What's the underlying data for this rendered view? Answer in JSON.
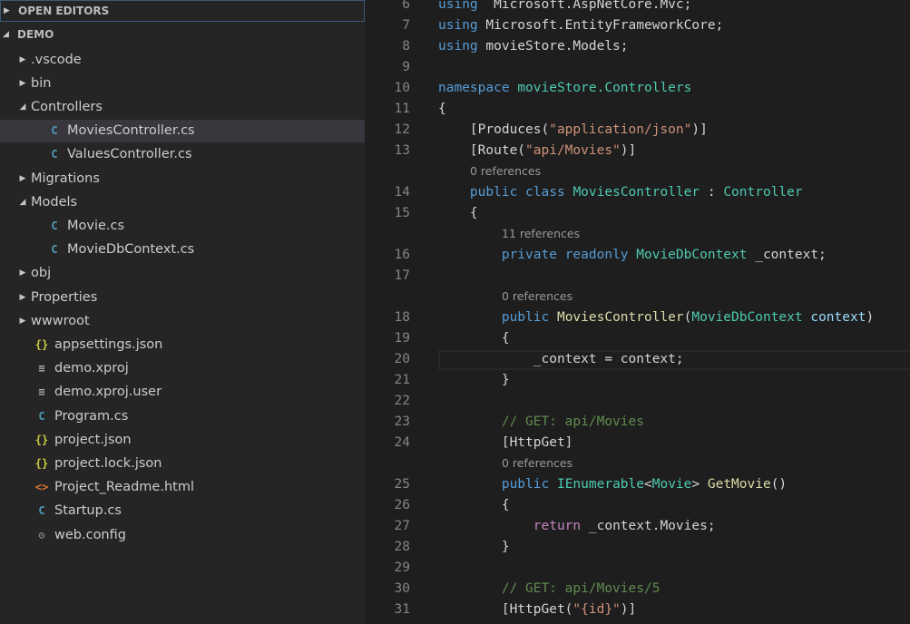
{
  "sidebar": {
    "open_editors_label": "OPEN EDITORS",
    "demo_label": "DEMO",
    "tree": [
      {
        "label": ".vscode",
        "kind": "folder",
        "expanded": false,
        "depth": 1
      },
      {
        "label": "bin",
        "kind": "folder",
        "expanded": false,
        "depth": 1
      },
      {
        "label": "Controllers",
        "kind": "folder",
        "expanded": true,
        "depth": 1
      },
      {
        "label": "MoviesController.cs",
        "kind": "cs",
        "depth": 2,
        "selected": true
      },
      {
        "label": "ValuesController.cs",
        "kind": "cs",
        "depth": 2
      },
      {
        "label": "Migrations",
        "kind": "folder",
        "expanded": false,
        "depth": 1
      },
      {
        "label": "Models",
        "kind": "folder",
        "expanded": true,
        "depth": 1
      },
      {
        "label": "Movie.cs",
        "kind": "cs",
        "depth": 2
      },
      {
        "label": "MovieDbContext.cs",
        "kind": "cs",
        "depth": 2
      },
      {
        "label": "obj",
        "kind": "folder",
        "expanded": false,
        "depth": 1
      },
      {
        "label": "Properties",
        "kind": "folder",
        "expanded": false,
        "depth": 1
      },
      {
        "label": "wwwroot",
        "kind": "folder",
        "expanded": false,
        "depth": 1
      },
      {
        "label": "appsettings.json",
        "kind": "json",
        "depth": 1
      },
      {
        "label": "demo.xproj",
        "kind": "doc",
        "depth": 1
      },
      {
        "label": "demo.xproj.user",
        "kind": "doc",
        "depth": 1
      },
      {
        "label": "Program.cs",
        "kind": "cs",
        "depth": 1
      },
      {
        "label": "project.json",
        "kind": "json",
        "depth": 1
      },
      {
        "label": "project.lock.json",
        "kind": "json",
        "depth": 1
      },
      {
        "label": "Project_Readme.html",
        "kind": "html",
        "depth": 1
      },
      {
        "label": "Startup.cs",
        "kind": "cs",
        "depth": 1
      },
      {
        "label": "web.config",
        "kind": "gear",
        "depth": 1
      }
    ],
    "icon_names": {
      "folder_collapsed": "chevron-right-icon",
      "folder_expanded": "chevron-down-icon",
      "cs": "csharp-file-icon",
      "json": "json-file-icon",
      "doc": "text-file-icon",
      "html": "html-file-icon",
      "gear": "config-file-icon"
    }
  },
  "editor": {
    "lines": [
      {
        "n": "6",
        "tokens": [
          [
            "kw",
            "using"
          ],
          [
            "",
            "  Microsoft.AspNetCore.Mvc;"
          ]
        ]
      },
      {
        "n": "7",
        "tokens": [
          [
            "kw",
            "using"
          ],
          [
            "",
            " Microsoft.EntityFrameworkCore;"
          ]
        ]
      },
      {
        "n": "8",
        "tokens": [
          [
            "kw",
            "using"
          ],
          [
            "",
            " movieStore.Models;"
          ]
        ]
      },
      {
        "n": "9",
        "tokens": []
      },
      {
        "n": "10",
        "tokens": [
          [
            "kw",
            "namespace"
          ],
          [
            "",
            " "
          ],
          [
            "ty",
            "movieStore.Controllers"
          ]
        ]
      },
      {
        "n": "11",
        "tokens": [
          [
            "",
            "{"
          ]
        ]
      },
      {
        "n": "12",
        "tokens": [
          [
            "",
            "    [Produces("
          ],
          [
            "st",
            "\"application/json\""
          ],
          [
            "",
            ")]"
          ]
        ]
      },
      {
        "n": "13",
        "tokens": [
          [
            "",
            "    [Route("
          ],
          [
            "st",
            "\"api/Movies\""
          ],
          [
            "",
            ")]"
          ]
        ]
      },
      {
        "n": "14",
        "lens": "0 references",
        "tokens": [
          [
            "",
            "    "
          ],
          [
            "kw",
            "public"
          ],
          [
            "",
            " "
          ],
          [
            "kw",
            "class"
          ],
          [
            "",
            " "
          ],
          [
            "ty",
            "MoviesController"
          ],
          [
            "",
            " : "
          ],
          [
            "ty",
            "Controller"
          ]
        ]
      },
      {
        "n": "15",
        "tokens": [
          [
            "",
            "    {"
          ]
        ]
      },
      {
        "n": "16",
        "lens": "11 references",
        "tokens": [
          [
            "",
            "        "
          ],
          [
            "kw",
            "private"
          ],
          [
            "",
            " "
          ],
          [
            "kw",
            "readonly"
          ],
          [
            "",
            " "
          ],
          [
            "ty",
            "MovieDbContext"
          ],
          [
            "",
            " _context;"
          ]
        ]
      },
      {
        "n": "17",
        "tokens": []
      },
      {
        "n": "18",
        "lens": "0 references",
        "tokens": [
          [
            "",
            "        "
          ],
          [
            "kw",
            "public"
          ],
          [
            "",
            " "
          ],
          [
            "fn",
            "MoviesController"
          ],
          [
            "",
            "("
          ],
          [
            "ty",
            "MovieDbContext"
          ],
          [
            "",
            " "
          ],
          [
            "pa",
            "context"
          ],
          [
            "",
            ")"
          ]
        ]
      },
      {
        "n": "19",
        "tokens": [
          [
            "",
            "        {"
          ]
        ]
      },
      {
        "n": "20",
        "tokens": [
          [
            "",
            "            _context = context;"
          ]
        ]
      },
      {
        "n": "21",
        "tokens": [
          [
            "",
            "        }"
          ]
        ]
      },
      {
        "n": "22",
        "tokens": []
      },
      {
        "n": "23",
        "tokens": [
          [
            "",
            "        "
          ],
          [
            "cm",
            "// GET: api/Movies"
          ]
        ]
      },
      {
        "n": "24",
        "tokens": [
          [
            "",
            "        [HttpGet]"
          ]
        ]
      },
      {
        "n": "25",
        "lens": "0 references",
        "tokens": [
          [
            "",
            "        "
          ],
          [
            "kw",
            "public"
          ],
          [
            "",
            " "
          ],
          [
            "ty",
            "IEnumerable"
          ],
          [
            "",
            "<"
          ],
          [
            "ty",
            "Movie"
          ],
          [
            "",
            "> "
          ],
          [
            "fn",
            "GetMovie"
          ],
          [
            "",
            "()"
          ]
        ]
      },
      {
        "n": "26",
        "tokens": [
          [
            "",
            "        {"
          ]
        ]
      },
      {
        "n": "27",
        "tokens": [
          [
            "",
            "            "
          ],
          [
            "ck",
            "return"
          ],
          [
            "",
            " _context.Movies;"
          ]
        ]
      },
      {
        "n": "28",
        "tokens": [
          [
            "",
            "        }"
          ]
        ]
      },
      {
        "n": "29",
        "tokens": []
      },
      {
        "n": "30",
        "tokens": [
          [
            "",
            "        "
          ],
          [
            "cm",
            "// GET: api/Movies/5"
          ]
        ]
      },
      {
        "n": "31",
        "tokens": [
          [
            "",
            "        [HttpGet("
          ],
          [
            "st",
            "\"{id}\""
          ],
          [
            "",
            ")]"
          ]
        ]
      }
    ],
    "current_line": "20"
  }
}
